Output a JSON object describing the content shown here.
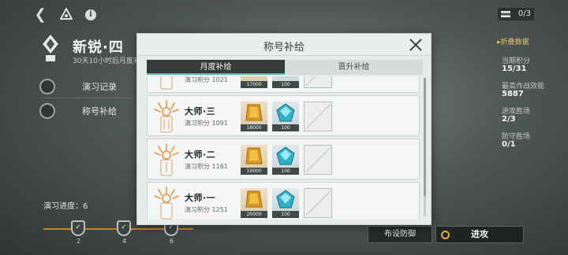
{
  "hud": {
    "res_value": "0/3"
  },
  "rank": {
    "title": "新锐·四",
    "subtitle": "30天10小时后月度补给"
  },
  "side_menu": [
    {
      "label": "演习记录"
    },
    {
      "label": "称号补给"
    }
  ],
  "progress": {
    "label": "演习进度：6",
    "markers": [
      "2",
      "4",
      "6"
    ]
  },
  "stats": {
    "header": "折叠数据",
    "items": [
      {
        "label": "当期积分",
        "value": "15/31"
      },
      {
        "label": "最高作战效能",
        "value": "5887"
      },
      {
        "label": "进攻胜场",
        "value": "2/3"
      },
      {
        "label": "防守胜场",
        "value": "0/1"
      }
    ]
  },
  "buttons": {
    "defense": "布设防御",
    "attack": "进攻"
  },
  "modal": {
    "title": "称号补给",
    "tabs": [
      {
        "label": "月度补给",
        "active": true
      },
      {
        "label": "晋升补给",
        "active": false
      }
    ],
    "cards": [
      {
        "title": "",
        "score": "演习积分 1021",
        "gold": "17000",
        "crystal": "100"
      },
      {
        "title": "大师·三",
        "score": "演习积分 1091",
        "gold": "18000",
        "crystal": "100"
      },
      {
        "title": "大师·二",
        "score": "演习积分 1161",
        "gold": "19000",
        "crystal": "100"
      },
      {
        "title": "大师·一",
        "score": "演习积分 1251",
        "gold": "20000",
        "crystal": "100"
      }
    ]
  },
  "colors": {
    "accent_orange": "#e6964a",
    "tab_active_bg": "#363c3b",
    "highlight_gold": "#e8c46a"
  }
}
